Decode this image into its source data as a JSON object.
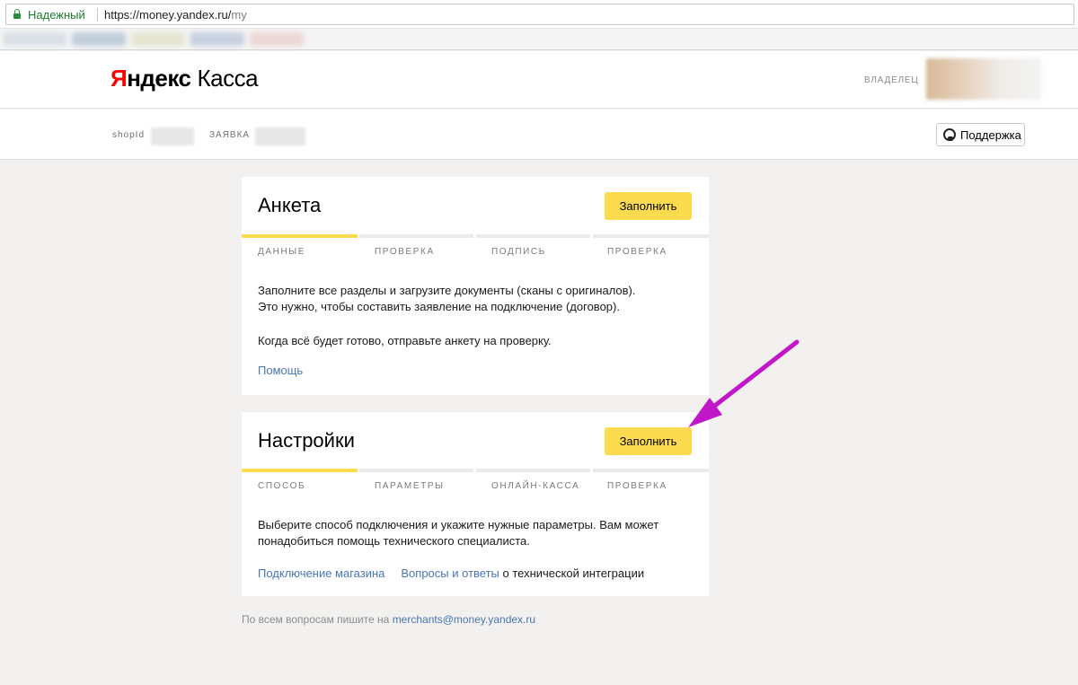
{
  "browser": {
    "secure_label": "Надежный",
    "url_host": "https://money.yandex.ru/",
    "url_path": "my"
  },
  "header": {
    "logo_ya": "Я",
    "logo_rest": "ндекс",
    "logo_product": "Касса",
    "role": "ВЛАДЕЛЕЦ"
  },
  "subheader": {
    "shop_label": "shopId",
    "request_label": "ЗАЯВКА",
    "support_label": "Поддержка"
  },
  "cards": [
    {
      "title": "Анкета",
      "button": "Заполнить",
      "steps": [
        "ДАННЫЕ",
        "ПРОВЕРКА",
        "ПОДПИСЬ",
        "ПРОВЕРКА"
      ],
      "active_step": 0,
      "text_line1": "Заполните все разделы и загрузите документы (сканы с оригиналов).",
      "text_line2": "Это нужно, чтобы составить заявление на подключение (договор).",
      "text_line3": "Когда всё будет готово, отправьте анкету на проверку.",
      "help_link": "Помощь"
    },
    {
      "title": "Настройки",
      "button": "Заполнить",
      "steps": [
        "СПОСОБ",
        "ПАРАМЕТРЫ",
        "ОНЛАЙН-КАССА",
        "ПРОВЕРКА"
      ],
      "active_step": 0,
      "text_line1": "Выберите способ подключения и укажите нужные параметры. Вам может",
      "text_line2": "понадобиться помощь технического специалиста.",
      "link1": "Подключение магазина",
      "link2": "Вопросы и ответы",
      "link2_suffix": " о технической интеграции"
    }
  ],
  "footer": {
    "text": "По всем вопросам пишите на ",
    "email": "merchants@money.yandex.ru"
  },
  "colors": {
    "accent_yellow": "#fddb4f",
    "link_blue": "#4a75b5",
    "logo_red": "#ff0000",
    "annotation_arrow": "#c217c9"
  }
}
